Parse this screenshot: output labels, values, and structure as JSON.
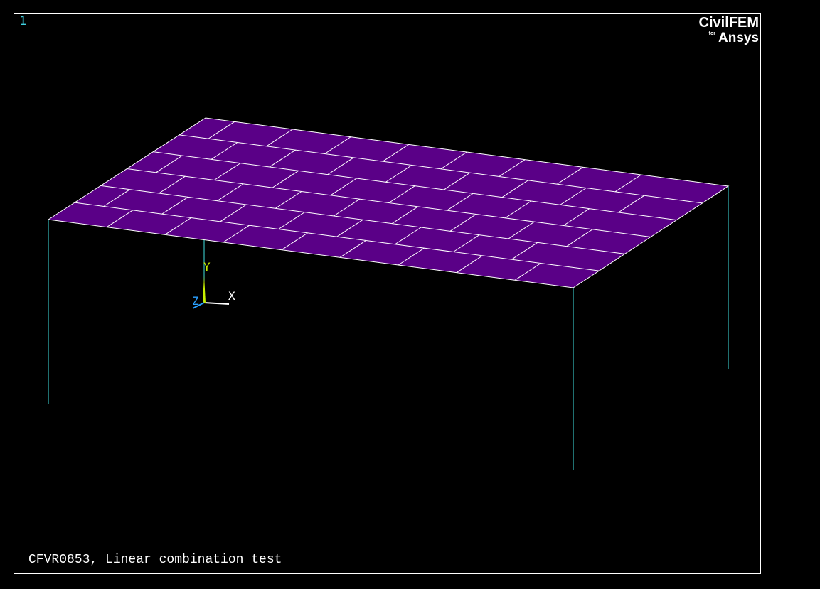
{
  "window": {
    "number": "1",
    "caption": "CFVR0853, Linear combination test"
  },
  "logo": {
    "main": "CivilFEM",
    "for": "for",
    "brand": "Ansys"
  },
  "triad": {
    "x_label": "X",
    "y_label": "Y",
    "z_label": "Z"
  },
  "model": {
    "slab_divisions_long": 9,
    "slab_divisions_short": 6,
    "columns": 4
  },
  "colors": {
    "background": "#000000",
    "frame": "#ffffff",
    "slab_fill": "#5a0087",
    "mesh_lines": "#ffffff",
    "columns": "#40e0e0",
    "window_number": "#3fd0e0",
    "axis_x": "#ffffff",
    "axis_y": "#c8f000",
    "axis_z": "#2aa0ff"
  }
}
